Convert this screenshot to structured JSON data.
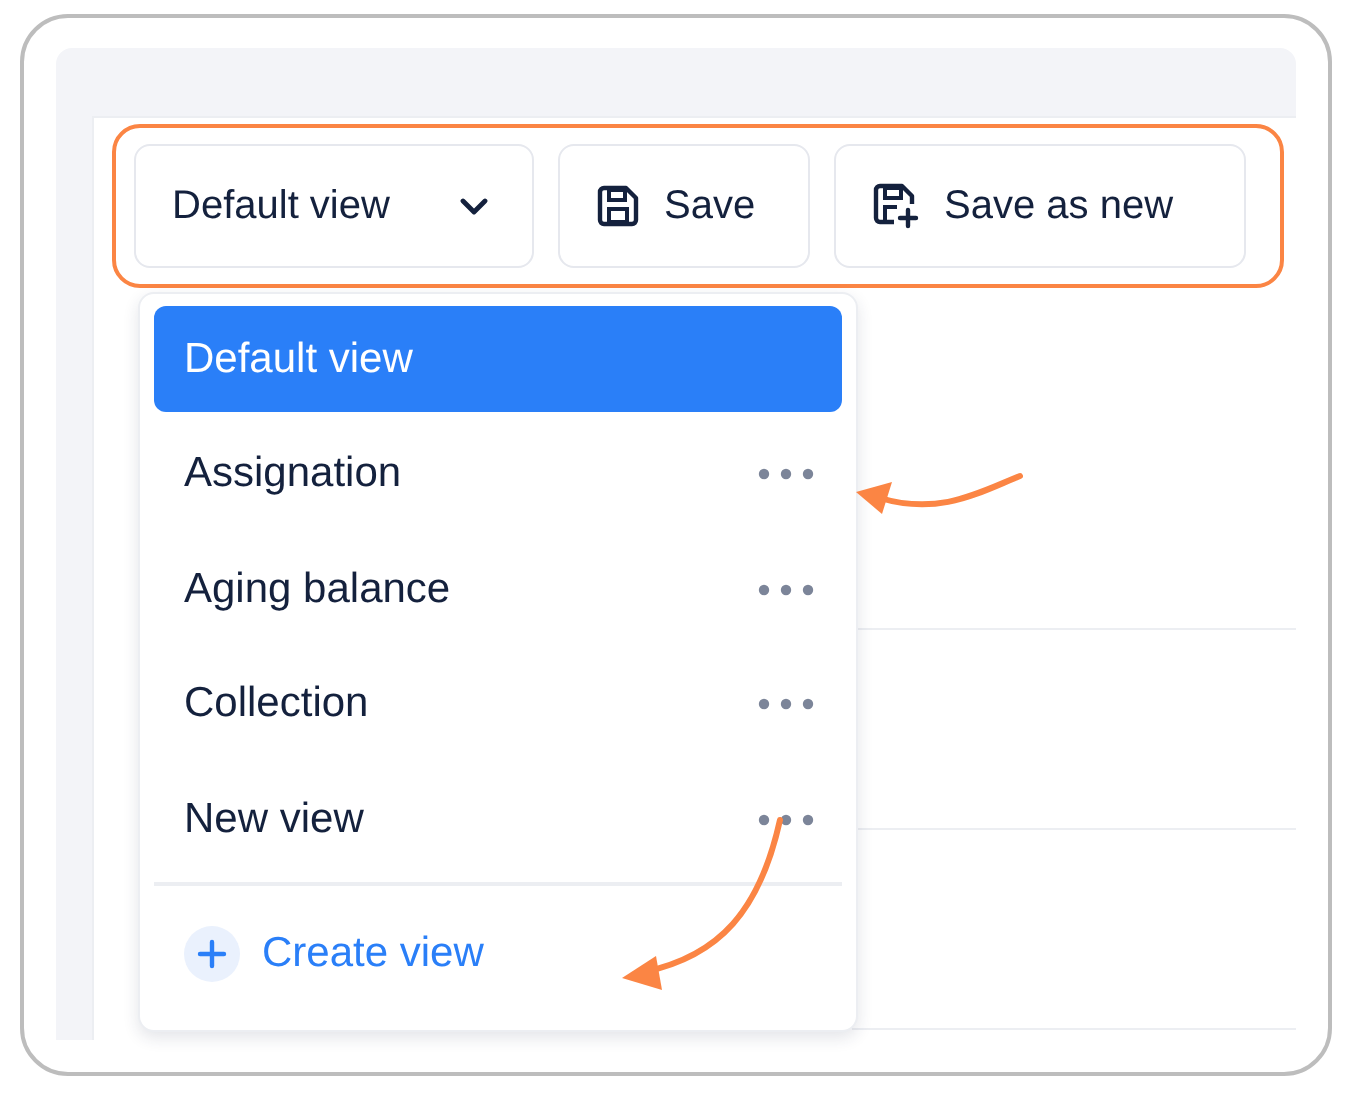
{
  "toolbar": {
    "view_button": {
      "label": "Default view"
    },
    "save_button": {
      "label": "Save"
    },
    "save_as_new_button": {
      "label": "Save as new"
    }
  },
  "view_menu": {
    "items": [
      {
        "label": "Default view",
        "selected": true,
        "has_more": false
      },
      {
        "label": "Assignation",
        "selected": false,
        "has_more": true
      },
      {
        "label": "Aging balance",
        "selected": false,
        "has_more": true
      },
      {
        "label": "Collection",
        "selected": false,
        "has_more": true
      },
      {
        "label": "New view",
        "selected": false,
        "has_more": true
      }
    ],
    "create_action": {
      "label": "Create view"
    }
  }
}
